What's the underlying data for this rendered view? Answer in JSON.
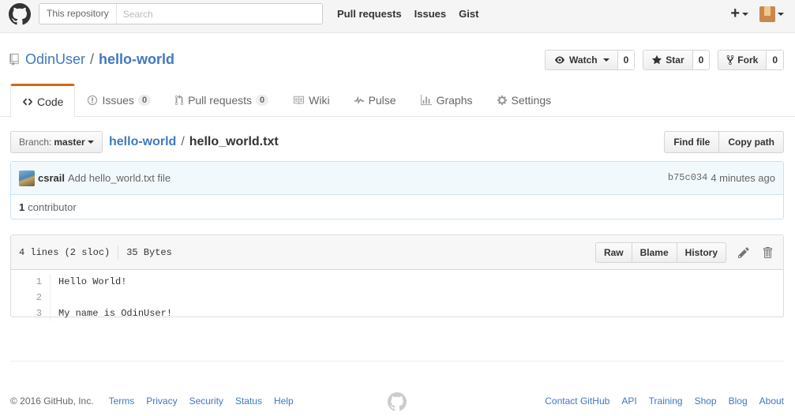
{
  "header": {
    "search_scope": "This repository",
    "search_placeholder": "Search",
    "nav": [
      "Pull requests",
      "Issues",
      "Gist"
    ],
    "plus": "+"
  },
  "repo": {
    "owner": "OdinUser",
    "separator": "/",
    "name": "hello-world",
    "actions": {
      "watch_label": "Watch",
      "watch_count": "0",
      "star_label": "Star",
      "star_count": "0",
      "fork_label": "Fork",
      "fork_count": "0"
    },
    "tabs": [
      {
        "label": "Code",
        "icon": "code-icon",
        "selected": true
      },
      {
        "label": "Issues",
        "count": "0",
        "icon": "issue-icon"
      },
      {
        "label": "Pull requests",
        "count": "0",
        "icon": "pull-request-icon"
      },
      {
        "label": "Wiki",
        "icon": "book-icon"
      },
      {
        "label": "Pulse",
        "icon": "pulse-icon"
      },
      {
        "label": "Graphs",
        "icon": "graph-icon"
      },
      {
        "label": "Settings",
        "icon": "gear-icon"
      }
    ]
  },
  "filenav": {
    "branch_prefix": "Branch:",
    "branch": "master",
    "breadcrumb_repo": "hello-world",
    "breadcrumb_sep": "/",
    "breadcrumb_file": "hello_world.txt",
    "find_file": "Find file",
    "copy_path": "Copy path"
  },
  "commit": {
    "author": "csrail",
    "message": "Add hello_world.txt file",
    "sha": "b75c034",
    "time": "4 minutes ago",
    "contributors_count": "1",
    "contributors_label": "contributor"
  },
  "file": {
    "lines_info": "4 lines (2 sloc)",
    "size": "35 Bytes",
    "raw": "Raw",
    "blame": "Blame",
    "history": "History",
    "lines": [
      {
        "num": "1",
        "text": "Hello World!"
      },
      {
        "num": "2",
        "text": ""
      },
      {
        "num": "3",
        "text": "My name is OdinUser!"
      }
    ]
  },
  "footer": {
    "copyright": "© 2016 GitHub, Inc.",
    "left_links": [
      "Terms",
      "Privacy",
      "Security",
      "Status",
      "Help"
    ],
    "right_links": [
      "Contact GitHub",
      "API",
      "Training",
      "Shop",
      "Blog",
      "About"
    ]
  },
  "colors": {
    "link": "#4078c0",
    "tab_accent": "#d26911",
    "commit_bg": "#f2f9fc",
    "commit_border": "#c9e2f2"
  }
}
